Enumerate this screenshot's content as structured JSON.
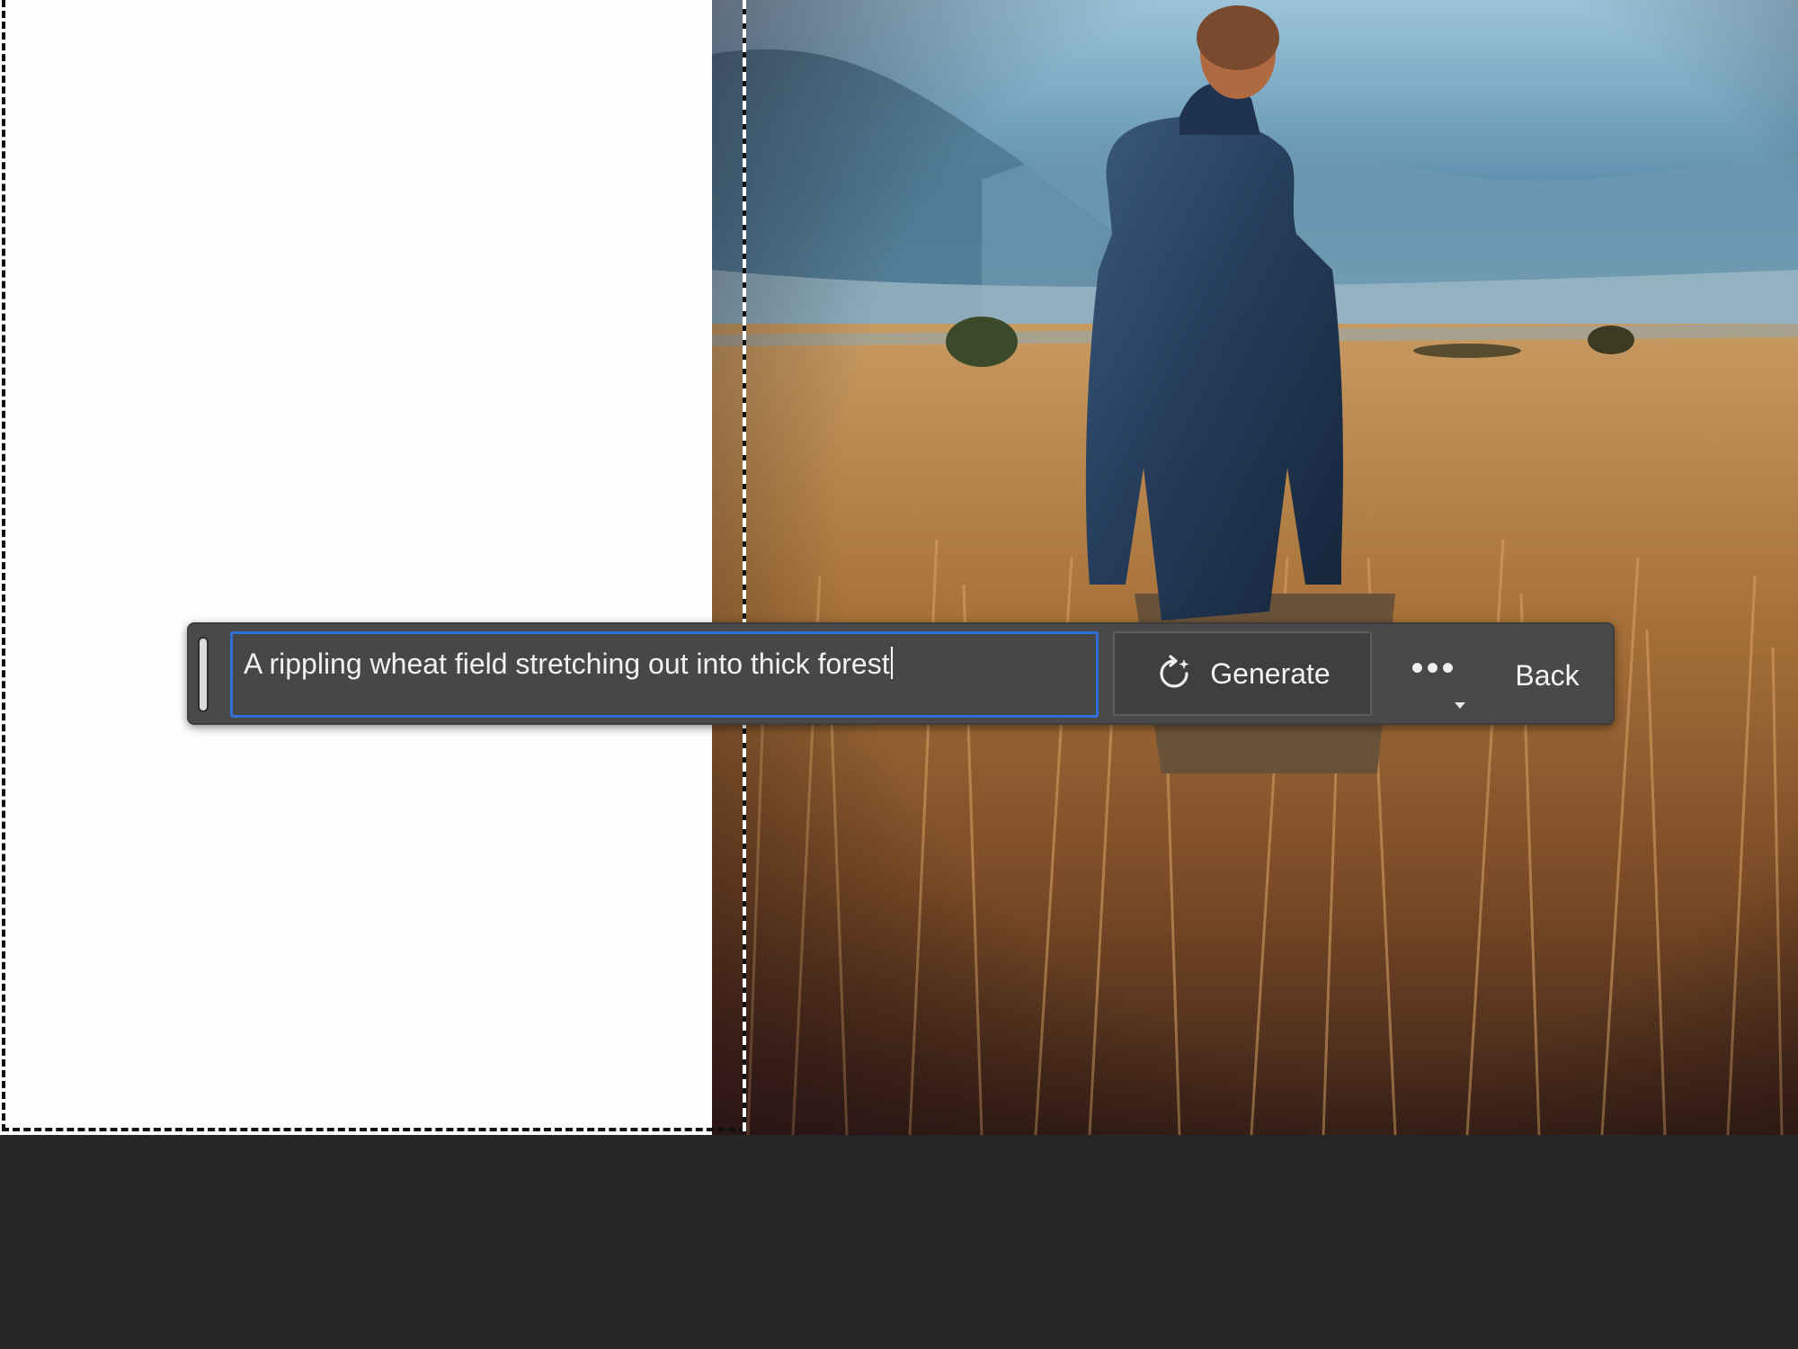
{
  "contextual_taskbar": {
    "prompt": {
      "value": "A rippling wheat field stretching out into thick forest",
      "placeholder": ""
    },
    "generate_label": "Generate",
    "more_label": "•••",
    "back_label": "Back",
    "accent_color": "#2f6fd6"
  },
  "icons": {
    "generate": "generate-refresh-sparkle-icon",
    "more": "more-options-icon",
    "caret": "chevron-down-icon"
  }
}
